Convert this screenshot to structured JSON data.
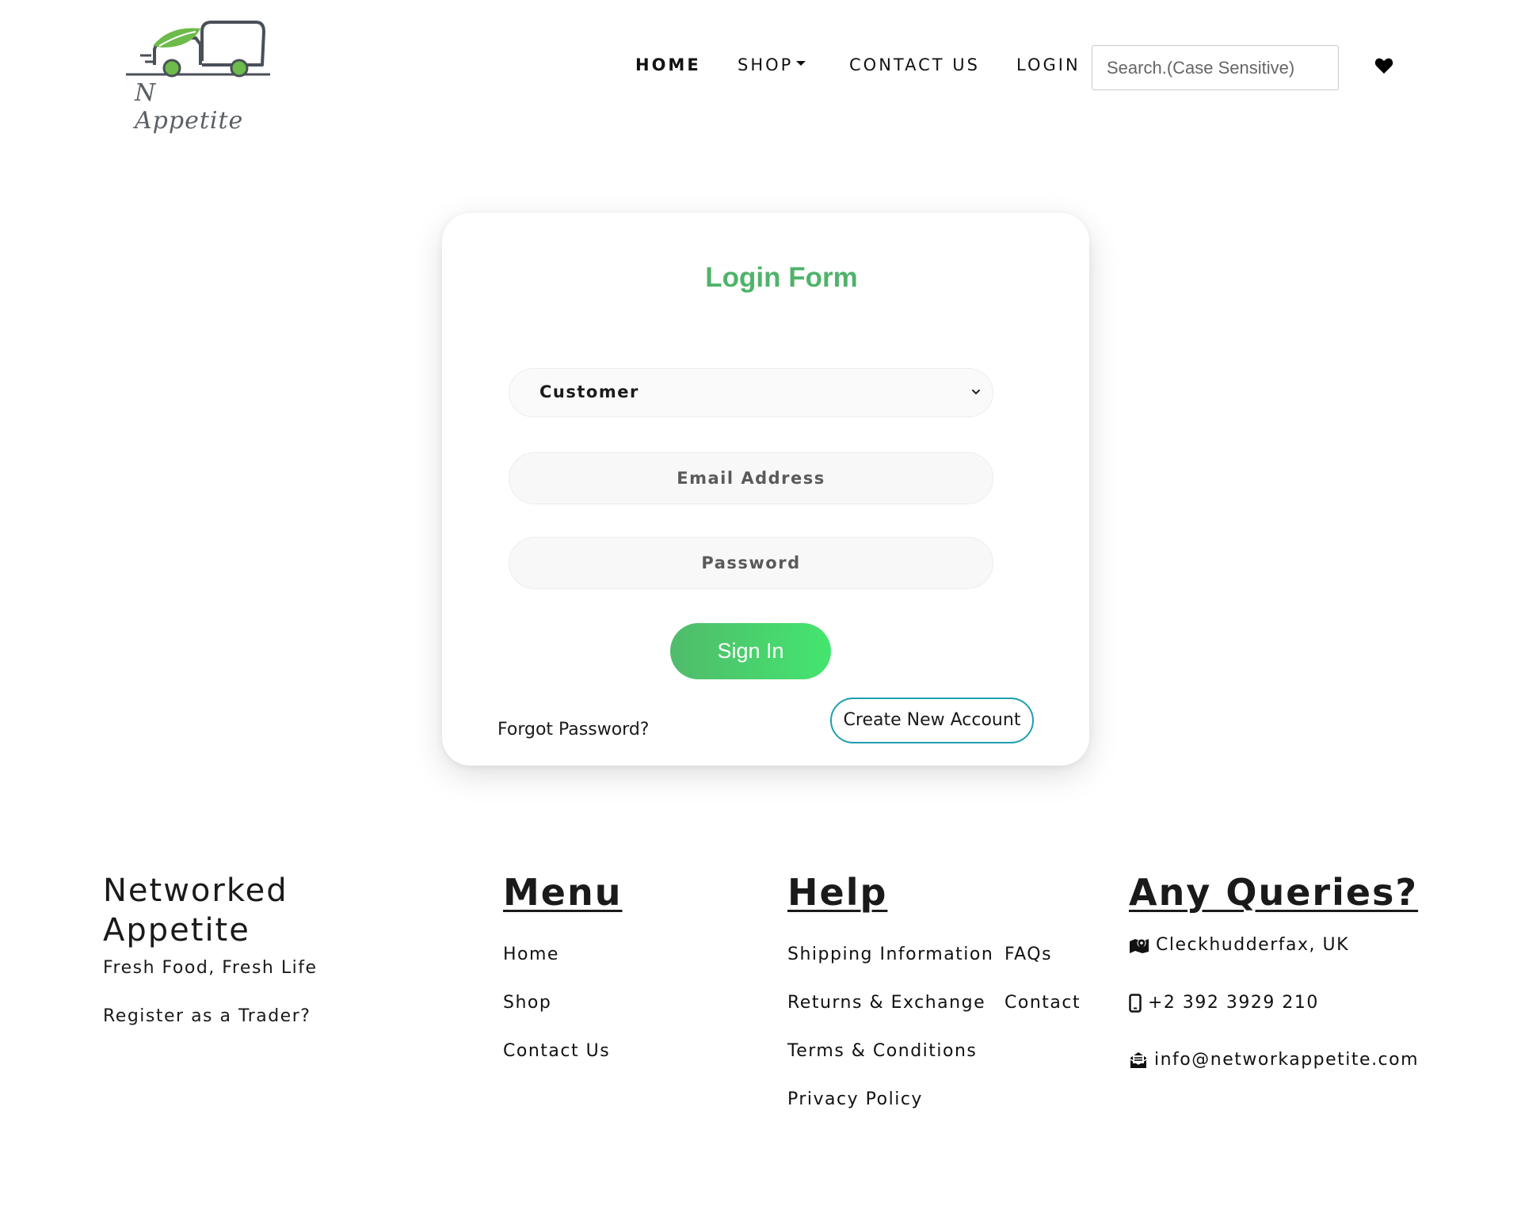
{
  "brand": {
    "logo_text": "N Appetite",
    "accent_color": "#4fb36a",
    "logo_icon": "delivery-truck-leaf-icon"
  },
  "nav": {
    "home": "HOME",
    "shop": "SHOP",
    "contact": "CONTACT US",
    "login": "LOGIN",
    "search_placeholder": "Search.(Case Sensitive)",
    "wishlist_icon": "heart-icon"
  },
  "login_form": {
    "title": "Login Form",
    "role_selected": "Customer",
    "email_placeholder": "Email Address",
    "password_placeholder": "Password",
    "signin_label": "Sign In",
    "forgot_label": "Forgot Password?",
    "create_account_label": "Create New Account",
    "signin_gradient": [
      "#50bb6c",
      "#44e56e"
    ],
    "create_border_color": "#1e9fb0"
  },
  "footer": {
    "brand_title_line1": "Networked",
    "brand_title_line2": "Appetite",
    "tagline": "Fresh Food, Fresh Life",
    "register_trader": "Register as a Trader?",
    "menu": {
      "heading": "Menu",
      "items": [
        "Home",
        "Shop",
        "Contact Us"
      ]
    },
    "help": {
      "heading": "Help",
      "items": [
        "Shipping Information",
        "Returns & Exchange",
        "Terms & Conditions",
        "Privacy Policy",
        "FAQs",
        "Contact"
      ]
    },
    "queries": {
      "heading": "Any Queries?",
      "location": "Cleckhudderfax, UK",
      "phone": "+2 392 3929 210",
      "email": "info@networkappetite.com",
      "icons": [
        "map-icon",
        "mobile-phone-icon",
        "envelope-icon"
      ]
    }
  }
}
